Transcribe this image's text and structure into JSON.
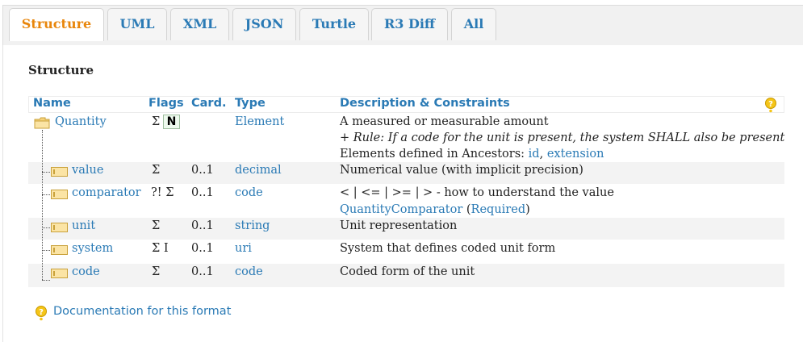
{
  "tabs": [
    {
      "label": "Structure",
      "active": true
    },
    {
      "label": "UML"
    },
    {
      "label": "XML"
    },
    {
      "label": "JSON"
    },
    {
      "label": "Turtle"
    },
    {
      "label": "R3 Diff"
    },
    {
      "label": "All"
    }
  ],
  "section_title": "Structure",
  "table": {
    "headers": [
      "Name",
      "Flags",
      "Card.",
      "Type",
      "Description & Constraints"
    ],
    "rows": [
      {
        "name": "Quantity",
        "flag_sigma": "Σ",
        "flag_box": "N",
        "card": "",
        "type": "Element",
        "desc_line1": "A measured or measurable amount",
        "desc_rule": "+ Rule: If a code for the unit is present, the system SHALL also be present",
        "desc_ancestors_prefix": "Elements defined in Ancestors: ",
        "desc_ancestors_link1": "id",
        "desc_ancestors_sep": ", ",
        "desc_ancestors_link2": "extension"
      },
      {
        "name": "value",
        "flags": "Σ",
        "card": "0..1",
        "type": "decimal",
        "desc": "Numerical value (with implicit precision)"
      },
      {
        "name": "comparator",
        "flags": "?! Σ",
        "card": "0..1",
        "type": "code",
        "desc": "< | <= | >= | > - how to understand the value",
        "binding_link": "QuantityComparator",
        "binding_open": " (",
        "binding_strength": "Required",
        "binding_close": ")"
      },
      {
        "name": "unit",
        "flags": "Σ",
        "card": "0..1",
        "type": "string",
        "desc": "Unit representation"
      },
      {
        "name": "system",
        "flags": "Σ I",
        "card": "0..1",
        "type": "uri",
        "desc": "System that defines coded unit form"
      },
      {
        "name": "code",
        "flags": "Σ",
        "card": "0..1",
        "type": "code",
        "desc": "Coded form of the unit"
      }
    ]
  },
  "doc_link": "Documentation for this format",
  "colors": {
    "link": "#2a7ab5",
    "active_tab": "#e8860c",
    "row_alt": "#f3f3f3"
  },
  "icons": [
    "help-icon",
    "folder-icon",
    "element-icon"
  ]
}
